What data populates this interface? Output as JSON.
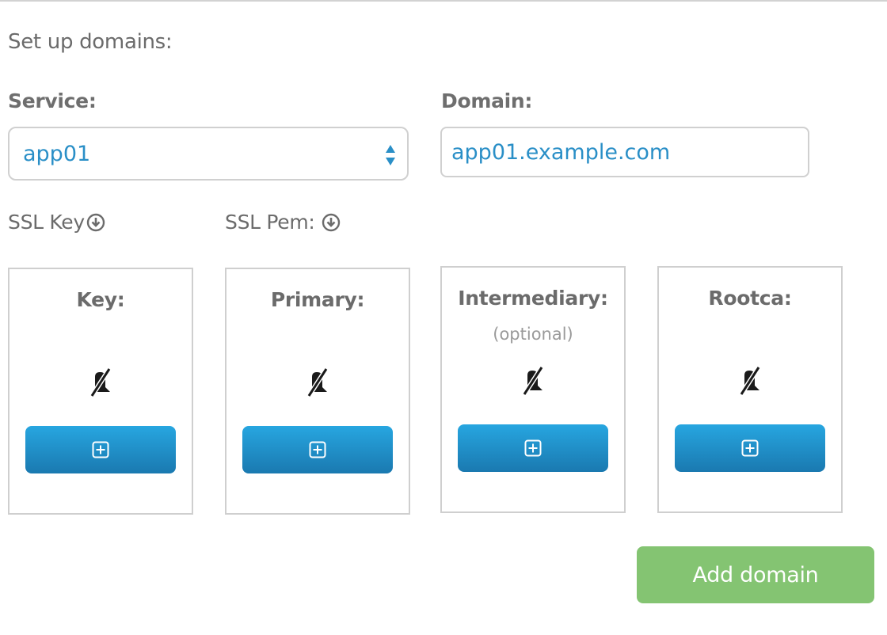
{
  "intro_text": "Set up domains:",
  "service": {
    "label": "Service:",
    "selected": "app01"
  },
  "domain": {
    "label": "Domain:",
    "value": "app01.example.com"
  },
  "ssl_key": {
    "label": "SSL Key",
    "icon": "download-circle-icon"
  },
  "ssl_pem": {
    "label": "SSL Pem:",
    "icon": "download-circle-icon"
  },
  "cards": [
    {
      "title": "Key:",
      "subtitle": "",
      "status_icon": "no-file-icon",
      "button_icon": "plus-square-icon"
    },
    {
      "title": "Primary:",
      "subtitle": "",
      "status_icon": "no-file-icon",
      "button_icon": "plus-square-icon"
    },
    {
      "title": "Intermediary:",
      "subtitle": "(optional)",
      "status_icon": "no-file-icon",
      "button_icon": "plus-square-icon"
    },
    {
      "title": "Rootca:",
      "subtitle": "",
      "status_icon": "no-file-icon",
      "button_icon": "plus-square-icon"
    }
  ],
  "add_button": {
    "label": "Add domain"
  },
  "colors": {
    "link_blue": "#2a8fc7",
    "button_blue_top": "#27a6e0",
    "button_blue_bottom": "#1a79b0",
    "add_green": "#84c472"
  }
}
